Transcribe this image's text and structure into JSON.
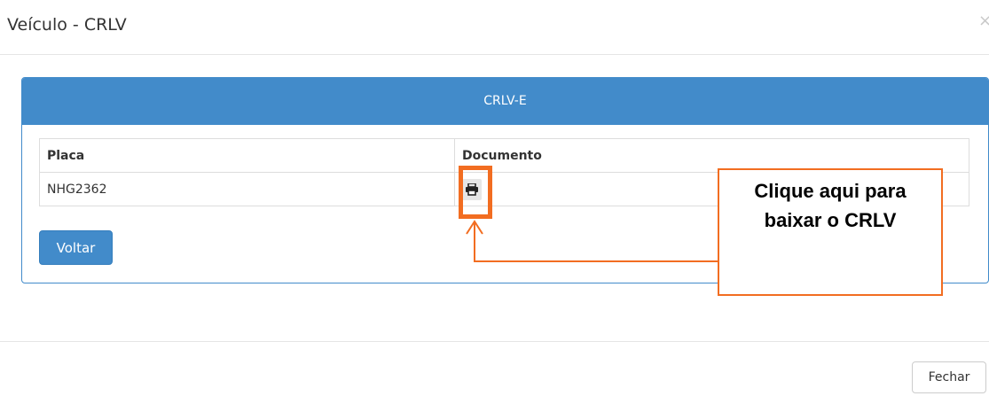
{
  "modal": {
    "title": "Veículo - CRLV",
    "close_glyph": "×"
  },
  "panel": {
    "heading": "CRLV-E",
    "table": {
      "headers": [
        "Placa",
        "Documento"
      ],
      "rows": [
        {
          "placa": "NHG2362",
          "documento_icon": "print-icon"
        }
      ]
    },
    "back_button": "Voltar"
  },
  "footer": {
    "close_button": "Fechar"
  },
  "annotation": {
    "callout_line1": "Clique aqui para",
    "callout_line2": "baixar o CRLV",
    "accent_color": "#f26d21"
  },
  "colors": {
    "primary": "#428bca",
    "border": "#dddddd"
  }
}
